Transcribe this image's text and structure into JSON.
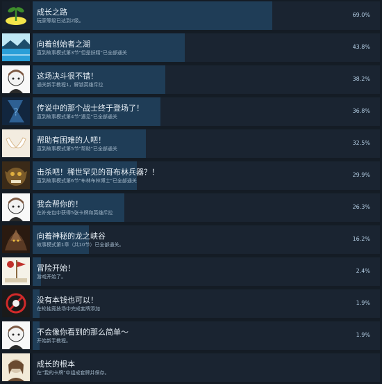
{
  "achievements": [
    {
      "title": "成长之路",
      "desc": "玩家等级已达到2级。",
      "percent": "69.0%",
      "value": 69.0,
      "icon": "sprout-icon",
      "colors": [
        "#f4e54a",
        "#3e8e2c",
        "#17202a"
      ]
    },
    {
      "title": "向着创始者之湖",
      "desc": "直到故事模式第3节\"但是妖精\"已全部通关",
      "percent": "43.8%",
      "value": 43.8,
      "icon": "lake-icon",
      "colors": [
        "#2a9fd8",
        "#bfe8f5",
        "#1d4e6b"
      ]
    },
    {
      "title": "这场决斗很不错！",
      "desc": "通关新手教程1，解锁英雄斥拉",
      "percent": "38.2%",
      "value": 38.2,
      "icon": "maid-character-icon",
      "colors": [
        "#f2f2f2",
        "#7d5a44",
        "#2a2a2a"
      ]
    },
    {
      "title": "传说中的那个战士终于登场了！",
      "desc": "直到故事模式第4节\"遇见\"已全部通关",
      "percent": "36.8%",
      "value": 36.8,
      "icon": "mystery-warrior-icon",
      "colors": [
        "#3a79b8",
        "#12263e",
        "#6ea8d8"
      ]
    },
    {
      "title": "帮助有困难的人吧！",
      "desc": "直到故事模式第5节\"帮助\"已全部通关",
      "percent": "32.5%",
      "value": 32.5,
      "icon": "helping-hands-icon",
      "colors": [
        "#f3ece0",
        "#d9b98d",
        "#ffffff"
      ]
    },
    {
      "title": "击杀吧！稀世罕见的哥布林兵器？！",
      "desc": "直到故事模式第6节\"布林布林博士\"已全部通关",
      "percent": "29.9%",
      "value": 29.9,
      "icon": "goblin-icon",
      "colors": [
        "#7a5a2a",
        "#e0b040",
        "#3a2a18"
      ]
    },
    {
      "title": "我会帮你的！",
      "desc": "在补充包中获得5张卡牌和英雄斥拉",
      "percent": "26.3%",
      "value": 26.3,
      "icon": "maid-character-icon",
      "colors": [
        "#f2f2f2",
        "#7d5a44",
        "#2a2a2a"
      ]
    },
    {
      "title": "向着神秘的龙之峡谷",
      "desc": "故事模式第1章（共10节）已全部通关。",
      "percent": "16.2%",
      "value": 16.2,
      "icon": "dragon-icon",
      "colors": [
        "#5a3a24",
        "#a0724a",
        "#2a1a10"
      ]
    },
    {
      "title": "冒险开始！",
      "desc": "游戏开始了。",
      "percent": "2.4%",
      "value": 2.4,
      "icon": "adventure-start-icon",
      "colors": [
        "#f5f2e8",
        "#c0302a",
        "#8a6a40"
      ]
    },
    {
      "title": "没有本钱也可以！",
      "desc": "在轮抽竞技场中完成套牌添加",
      "percent": "1.9%",
      "value": 1.9,
      "icon": "no-money-icon",
      "colors": [
        "#1a1a1a",
        "#d02a2a",
        "#f2f2f2"
      ]
    },
    {
      "title": "不会像你看到的那么简单～",
      "desc": "开始新手教程。",
      "percent": "1.9%",
      "value": 1.9,
      "icon": "maid-character-icon",
      "colors": [
        "#f2f2f2",
        "#7d5a44",
        "#2a2a2a"
      ]
    },
    {
      "title": "成长的根本",
      "desc": "在\"我的卡牌\"中组成套牌并保存。",
      "percent": "",
      "value": 0,
      "icon": "girl-portrait-icon",
      "colors": [
        "#d8c8b0",
        "#6a4a30",
        "#f2ead8"
      ]
    }
  ]
}
